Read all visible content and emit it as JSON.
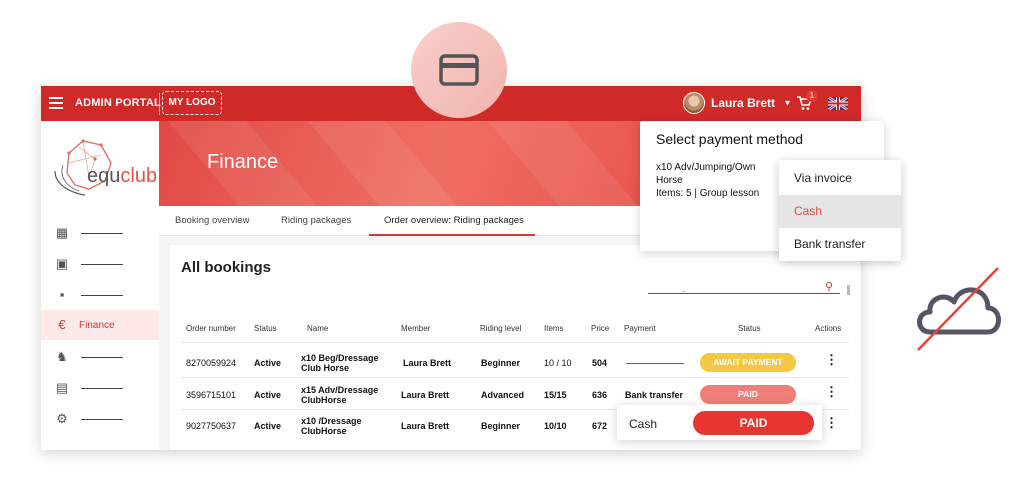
{
  "topbar": {
    "portal_label": "ADMIN PORTAL",
    "logo_label": "MY LOGO",
    "user_name": "Laura Brett",
    "cart_count": "1"
  },
  "brand": {
    "prefix": "equ",
    "suffix": "club"
  },
  "sidebar": {
    "active_label": "Finance",
    "active_icon": "€"
  },
  "hero": {
    "title": "Finance"
  },
  "tabs": [
    {
      "label": "Booking overview"
    },
    {
      "label": "Riding packages"
    },
    {
      "label": "Order overview: Riding packages"
    }
  ],
  "table": {
    "title": "All bookings",
    "search_value": "-",
    "headers": [
      "Order number",
      "Status",
      "Name",
      "Member",
      "Riding level",
      "Items",
      "Price",
      "Payment",
      "Status",
      "Actions"
    ],
    "rows": [
      {
        "order": "8270059924",
        "status": "Active",
        "name1": "x10 Beg/Dressage",
        "name2": "Club Horse",
        "member": "Laura Brett",
        "level": "Beginner",
        "items": "10 / 10",
        "price": "504",
        "payment": "",
        "pay_status": "AWAIT PAYMENT"
      },
      {
        "order": "3596715101",
        "status": "Active",
        "name1": "x15 Adv/Dressage",
        "name2": "ClubHorse",
        "member": "Laura Brett",
        "level": "Advanced",
        "items": "15/15",
        "price": "636",
        "payment": "Bank transfer",
        "pay_status": "PAID"
      },
      {
        "order": "9027750637",
        "status": "Active",
        "name1": "x10 /Dressage",
        "name2": "ClubHorse",
        "member": "Laura Brett",
        "level": "Beginner",
        "items": "10/10",
        "price": "672",
        "payment": "",
        "pay_status": ""
      }
    ]
  },
  "popup": {
    "title": "Select payment method",
    "line1": "x10 Adv/Jumping/Own",
    "line2": "Horse",
    "line3": "Items: 5 | Group lesson"
  },
  "payment_menu": {
    "options": [
      "Via invoice",
      "Cash",
      "Bank transfer"
    ],
    "selected": "Cash"
  },
  "cash_row": {
    "payment": "Cash",
    "status": "PAID"
  },
  "colors": {
    "primary": "#cf2a27",
    "await": "#f5c842",
    "paid_light": "#ef7f78",
    "paid": "#e8352f"
  }
}
